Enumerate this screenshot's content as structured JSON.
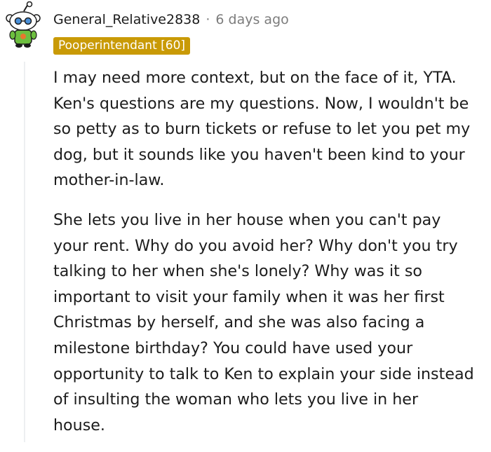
{
  "comment": {
    "username": "General_Relative2838",
    "separator": "·",
    "timestamp": "6 days ago",
    "flair": "Pooperintendant [60]",
    "paragraphs": [
      "I may need more context, but on the face of it, YTA. Ken's questions are my questions. Now, I wouldn't be so petty as to burn tickets or refuse to let you pet my dog, but it sounds like you haven't been kind to your mother-in-law.",
      "She lets you live in her house when you can't pay your rent. Why do you avoid her? Why don't you try talking to her when she's lonely? Why was it so important to visit your family when it was her first Christmas by herself, and she was also facing a milestone birthday? You could have used your opportunity to talk to Ken to explain your side instead of insulting the woman who lets you live in her house."
    ]
  },
  "colors": {
    "flair_bg": "#c99a06",
    "meta_text": "#7c7c7c",
    "thread_line": "#edeff1"
  },
  "icons": {
    "avatar": "snoo-avatar-icon"
  }
}
